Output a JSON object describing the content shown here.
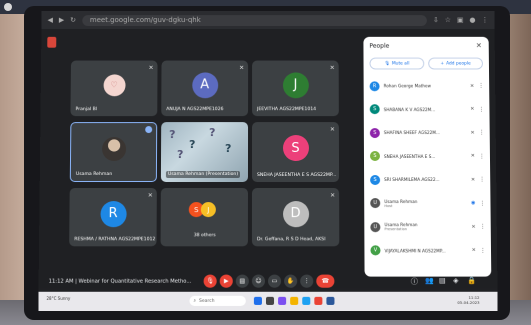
{
  "browser": {
    "url": "meet.google.com/guv-dgku-qhk"
  },
  "tiles": [
    {
      "name": "Pranjal Bl",
      "initial": "",
      "color": "#f4d6d0"
    },
    {
      "name": "ANUJA N AGS22MPE1026",
      "initial": "A",
      "color": "#5c6bc0"
    },
    {
      "name": "JEEVITHA AGS22MPE1014",
      "initial": "J",
      "color": "#2e7d32"
    },
    {
      "name": "Usama Rehman",
      "initial": "",
      "color": "#555"
    },
    {
      "name": "Usama Rehman (Presentation)",
      "initial": "",
      "color": ""
    },
    {
      "name": "SNEHA JASEENTHA E S AGS22MP...",
      "initial": "S",
      "color": "#ec407a"
    },
    {
      "name": "RESHMA / RATHNA AGS22MPE1012",
      "initial": "R",
      "color": "#1e88e5"
    },
    {
      "name": "38 others",
      "initial": "S J",
      "color": ""
    },
    {
      "name": "Dr. Geffana, R S D Head, AKSI",
      "initial": "D",
      "color": "#bdbdbd"
    }
  ],
  "people": {
    "title": "People",
    "mute_all": "Mute all",
    "add_people": "Add people",
    "rows": [
      {
        "initial": "R",
        "color": "#1e88e5",
        "name": "Rohan George Mathew",
        "sub": ""
      },
      {
        "initial": "S",
        "color": "#00897b",
        "name": "SHABANA K V AGS22M...",
        "sub": ""
      },
      {
        "initial": "S",
        "color": "#8e24aa",
        "name": "SHAFINA SHEEF AGS22M...",
        "sub": ""
      },
      {
        "initial": "S",
        "color": "#7cb342",
        "name": "SNEHA JASEENTHA E S...",
        "sub": ""
      },
      {
        "initial": "S",
        "color": "#1e88e5",
        "name": "SRI SHARMILEMA AGS22...",
        "sub": ""
      },
      {
        "initial": "U",
        "color": "#555",
        "name": "Usama Rehman",
        "sub": "Host"
      },
      {
        "initial": "U",
        "color": "#555",
        "name": "Usama Rehman",
        "sub": "Presentation"
      },
      {
        "initial": "V",
        "color": "#43a047",
        "name": "VIJAYALAKSHMI N AGS22MP...",
        "sub": ""
      }
    ]
  },
  "controls": {
    "time_title": "11:12 AM  |  Webinar for Quantitative Research Metho..."
  },
  "taskbar": {
    "weather": "28°C Sunny",
    "search": "Search",
    "clock_time": "11:12",
    "clock_date": "05-04-2023"
  },
  "icons": {
    "mic": "mic-off-icon",
    "cam": "camera-icon",
    "cc": "captions-icon",
    "hand": "raise-hand-icon",
    "present": "present-icon",
    "more": "more-icon",
    "end": "end-call-icon",
    "info": "info-icon",
    "people": "people-icon",
    "chat": "chat-icon",
    "activities": "activities-icon",
    "lock": "lock-icon"
  }
}
